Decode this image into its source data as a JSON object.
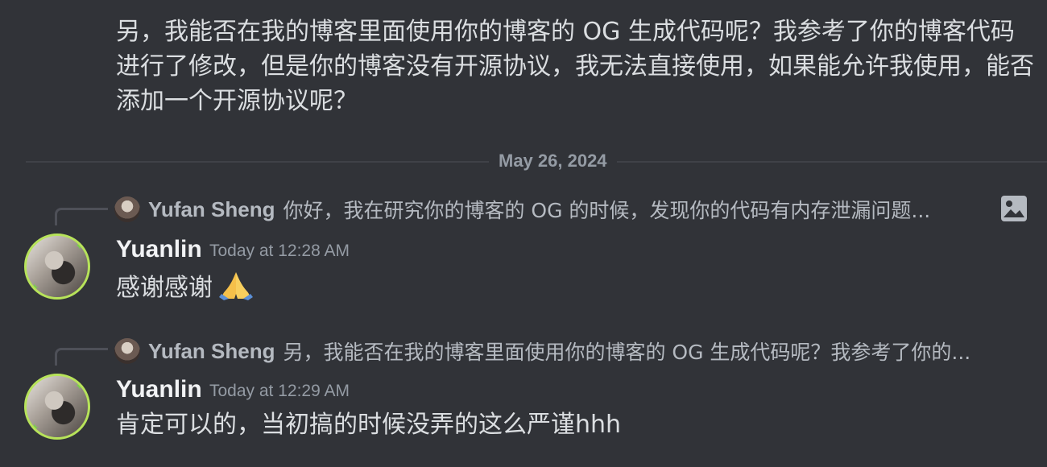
{
  "previous_message": {
    "text": "另，我能否在我的博客里面使用你的博客的 OG 生成代码呢？我参考了你的博客代码进行了修改，但是你的博客没有开源协议，我无法直接使用，如果能允许我使用，能否添加一个开源协议呢？"
  },
  "date_divider": "May 26, 2024",
  "messages": [
    {
      "reply": {
        "author": "Yufan Sheng",
        "text": "你好，我在研究你的博客的 OG 的时候，发现你的代码有内存泄漏问题...",
        "attachment_icon": "image-icon"
      },
      "author": "Yuanlin",
      "timestamp": "Today at 12:28 AM",
      "text": "感谢感谢",
      "emoji": "folded-hands"
    },
    {
      "reply": {
        "author": "Yufan Sheng",
        "text": "另，我能否在我的博客里面使用你的博客的 OG 生成代码呢？我参考了你的..."
      },
      "author": "Yuanlin",
      "timestamp": "Today at 12:29 AM",
      "text": "肯定可以的，当初搞的时候没弄的这么严谨hhh"
    }
  ],
  "colors": {
    "background": "#313338",
    "text": "#dbdee1",
    "muted": "#949ba4",
    "avatar_ring": "#b7e35a"
  }
}
